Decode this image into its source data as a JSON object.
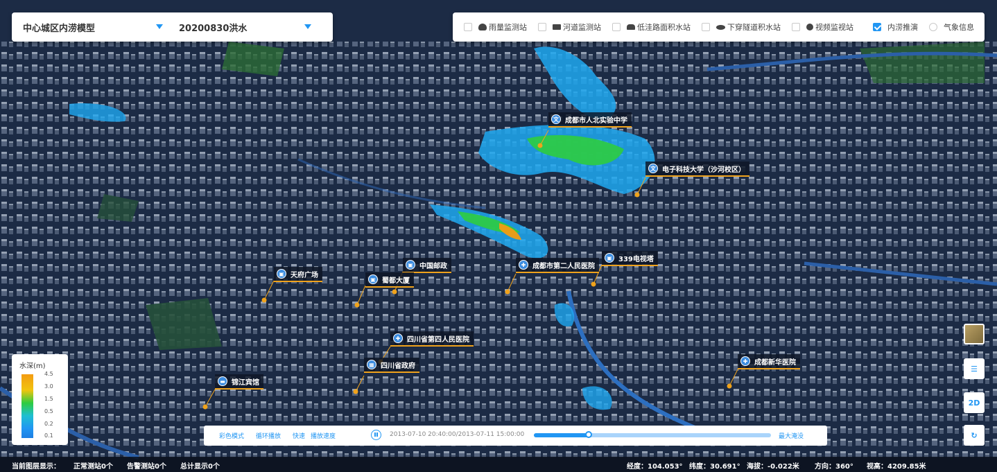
{
  "model_select": {
    "value": "中心城区内涝模型"
  },
  "event_select": {
    "value": "20200830洪水"
  },
  "layers": [
    {
      "label": "雨量监测站",
      "icon": "cloud-icon",
      "checked": false
    },
    {
      "label": "河道监测站",
      "icon": "river-station-icon",
      "checked": false
    },
    {
      "label": "低洼路面积水站",
      "icon": "car-flood-icon",
      "checked": false
    },
    {
      "label": "下穿隧道积水站",
      "icon": "tunnel-icon",
      "checked": false
    },
    {
      "label": "视频监视站",
      "icon": "camera-icon",
      "checked": false
    },
    {
      "label": "内涝推演",
      "checked": true
    },
    {
      "label": "气象信息",
      "checked": false
    }
  ],
  "pois": [
    {
      "label": "成都市人北实验中学",
      "icon": "school-icon"
    },
    {
      "label": "电子科技大学（沙河校区）",
      "icon": "school-icon"
    },
    {
      "label": "中国邮政",
      "icon": "building-icon"
    },
    {
      "label": "成都市第二人民医院",
      "icon": "hospital-icon"
    },
    {
      "label": "339电视塔",
      "icon": "building-icon"
    },
    {
      "label": "天府广场",
      "icon": "building-icon"
    },
    {
      "label": "蜀都大厦",
      "icon": "building-icon"
    },
    {
      "label": "四川省第四人民医院",
      "icon": "hospital-icon"
    },
    {
      "label": "四川省政府",
      "icon": "government-icon"
    },
    {
      "label": "锦江宾馆",
      "icon": "hotel-icon"
    },
    {
      "label": "成都新华医院",
      "icon": "hospital-icon"
    }
  ],
  "legend": {
    "title": "水深(m)",
    "ticks": [
      "4.5",
      "3.0",
      "1.5",
      "0.5",
      "0.2",
      "0.1"
    ]
  },
  "playback": {
    "color_mode": "彩色模式",
    "loop": "循环播放",
    "speed": "快速",
    "speed_label": "播放速度",
    "time": "2013-07-10 20:40:00/2013-07-11 15:00:00",
    "progress": 0.23,
    "max_label": "最大淹没"
  },
  "tools": {
    "view_2d": "2D"
  },
  "status": {
    "layer_display": "当前图层显示：",
    "normal_stations": "正常测站0个",
    "alarm_stations": "告警测站0个",
    "total": "总计显示0个",
    "longitude": "经度：104.053°",
    "latitude": "纬度：30.691°",
    "altitude": "海拔：-0.022米",
    "direction": "方向：360°",
    "view_height": "视高：4209.85米"
  },
  "colors": {
    "accent": "#2196f3",
    "map_bg": "#1c2b45",
    "flood_green": "#2ecc40",
    "flood_blue": "#1fa8f0",
    "flood_orange": "#f39c12"
  }
}
